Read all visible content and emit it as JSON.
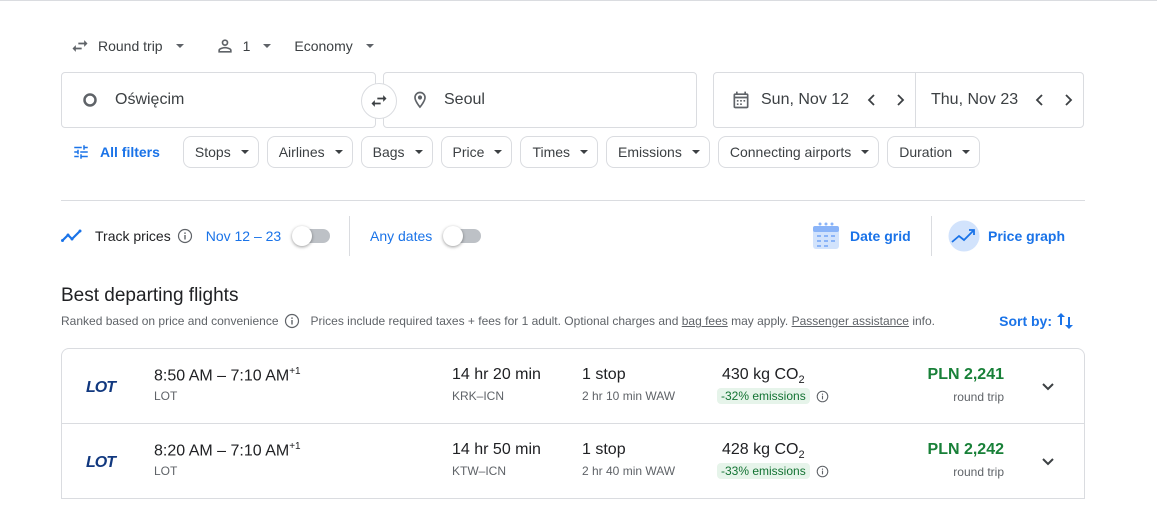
{
  "trip_options": {
    "trip_type": "Round trip",
    "passengers": "1",
    "cabin": "Economy"
  },
  "search": {
    "origin": "Oświęcim",
    "destination": "Seoul",
    "depart_date": "Sun, Nov 12",
    "return_date": "Thu, Nov 23"
  },
  "filters": {
    "all_filters": "All filters",
    "chips": [
      "Stops",
      "Airlines",
      "Bags",
      "Price",
      "Times",
      "Emissions",
      "Connecting airports",
      "Duration"
    ]
  },
  "track": {
    "track_prices": "Track prices",
    "track_dates": "Nov 12 – 23",
    "any_dates": "Any dates",
    "date_grid": "Date grid",
    "price_graph": "Price graph"
  },
  "results_header": {
    "title": "Best departing flights",
    "ranked": "Ranked based on price and convenience",
    "prices_note_1": "Prices include required taxes + fees for 1 adult. Optional charges and ",
    "bag_fees": "bag fees",
    "prices_note_2": " may apply. ",
    "passenger_assistance": "Passenger assistance",
    "prices_note_3": " info.",
    "sort_by": "Sort by:"
  },
  "flights": [
    {
      "depart": "8:50 AM",
      "dash": "–",
      "arrive": "7:10 AM",
      "plus_days": "+1",
      "airline": "LOT",
      "duration": "14 hr 20 min",
      "route": "KRK–ICN",
      "stops": "1 stop",
      "layover": "2 hr 10 min WAW",
      "emissions_value": "430 kg CO",
      "emissions_sub": "2",
      "emissions_badge": "-32% emissions",
      "price": "PLN 2,241",
      "price_type": "round trip"
    },
    {
      "depart": "8:20 AM",
      "dash": "–",
      "arrive": "7:10 AM",
      "plus_days": "+1",
      "airline": "LOT",
      "duration": "14 hr 50 min",
      "route": "KTW–ICN",
      "stops": "1 stop",
      "layover": "2 hr 40 min WAW",
      "emissions_value": "428 kg CO",
      "emissions_sub": "2",
      "emissions_badge": "-33% emissions",
      "price": "PLN 2,242",
      "price_type": "round trip"
    }
  ],
  "colors": {
    "accent": "#1a73e8",
    "price_green": "#188038",
    "badge_bg": "#e6f4ea",
    "logo_navy": "#11387f"
  }
}
